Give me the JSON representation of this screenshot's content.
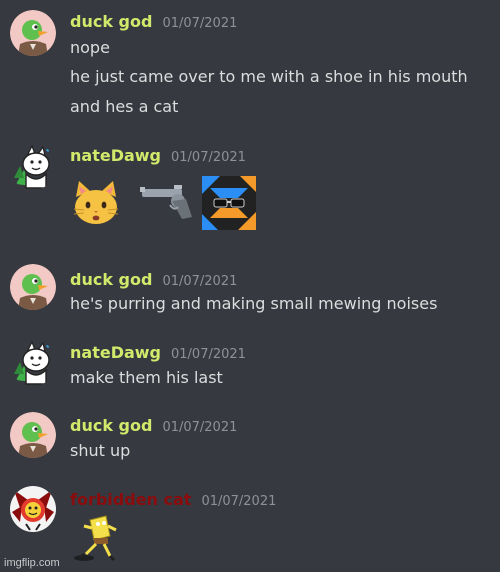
{
  "colors": {
    "background": "#36393f",
    "duck_god_name": "#d2e96b",
    "natedawg_name": "#d2e96b",
    "forbidden_cat_name": "#8b0c0c",
    "timestamp": "#8e9297",
    "message_text": "#dcddde"
  },
  "messages": [
    {
      "author": "duck god",
      "timestamp": "01/07/2021",
      "avatar_icon": "duck-avatar-icon",
      "lines": [
        "nope",
        "he just came over to me with a shoe in his mouth",
        "and hes a cat"
      ]
    },
    {
      "author": "nateDawg",
      "timestamp": "01/07/2021",
      "avatar_icon": "white-dog-avatar-icon",
      "emojis": [
        "cat-face-emoji",
        "pistol-emoji",
        "sunglasses-custom-emoji"
      ]
    },
    {
      "author": "duck god",
      "timestamp": "01/07/2021",
      "avatar_icon": "duck-avatar-icon",
      "lines": [
        "he's purring and making small mewing noises"
      ]
    },
    {
      "author": "nateDawg",
      "timestamp": "01/07/2021",
      "avatar_icon": "white-dog-avatar-icon",
      "lines": [
        "make them his last"
      ]
    },
    {
      "author": "duck god",
      "timestamp": "01/07/2021",
      "avatar_icon": "duck-avatar-icon",
      "lines": [
        "shut up"
      ]
    },
    {
      "author": "forbidden cat",
      "timestamp": "01/07/2021",
      "avatar_icon": "red-cat-avatar-icon",
      "emojis": [
        "dancing-sponge-gif"
      ]
    }
  ],
  "watermark": "imgflip.com"
}
